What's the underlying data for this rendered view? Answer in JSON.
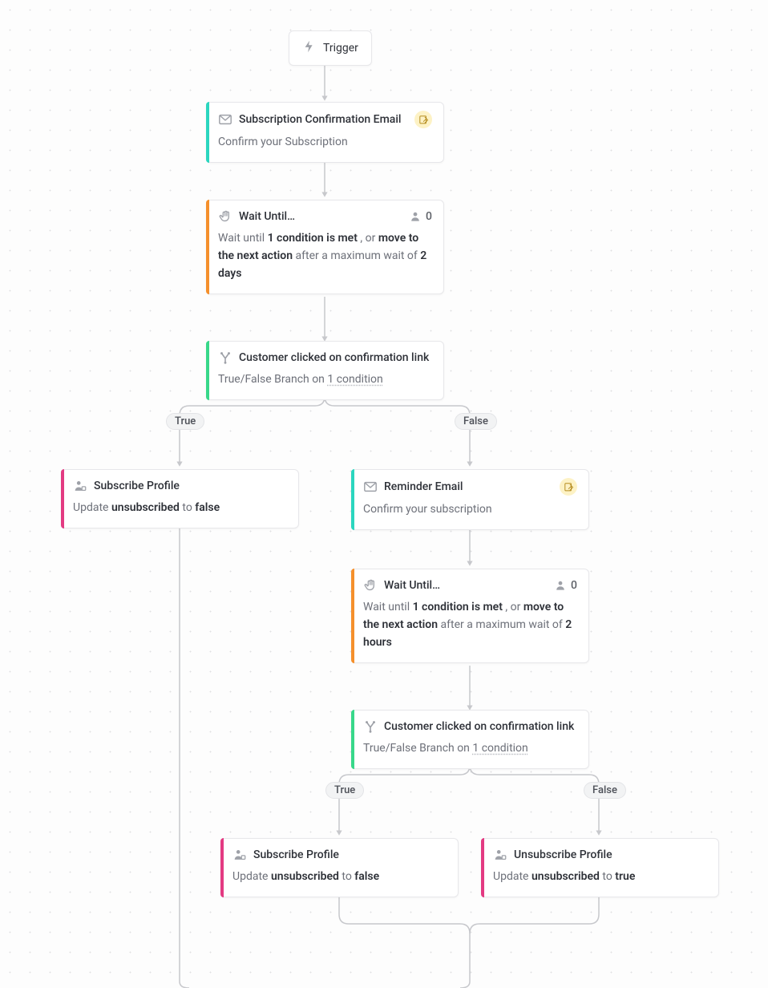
{
  "trigger": {
    "label": "Trigger"
  },
  "branch": {
    "true_label": "True",
    "false_label": "False",
    "body_prefix": "True/False Branch on ",
    "body_link": "1 condition"
  },
  "wait": {
    "title": "Wait Until…",
    "prefix": "Wait until ",
    "cond": "1 condition is met",
    "sep": " , or ",
    "move": "move to the next action",
    "after": " after a maximum wait of ",
    "count0": "0"
  },
  "nodes": {
    "email1": {
      "title": "Subscription Confirmation Email",
      "body": "Confirm your Subscription"
    },
    "wait1_duration": "2 days",
    "branch1_title": "Customer clicked on confirmation link",
    "subscribe1": {
      "title": "Subscribe Profile",
      "prefix": "Update ",
      "field": "unsubscribed",
      "mid": " to ",
      "val": "false"
    },
    "email2": {
      "title": "Reminder Email",
      "body": "Confirm your subscription"
    },
    "wait2_duration": "2 hours",
    "branch2_title": "Customer clicked on confirmation link",
    "subscribe2": {
      "title": "Subscribe Profile",
      "prefix": "Update ",
      "field": "unsubscribed",
      "mid": " to ",
      "val": "false"
    },
    "unsubscribe": {
      "title": "Unsubscribe Profile",
      "prefix": "Update ",
      "field": "unsubscribed",
      "mid": " to ",
      "val": "true"
    }
  }
}
